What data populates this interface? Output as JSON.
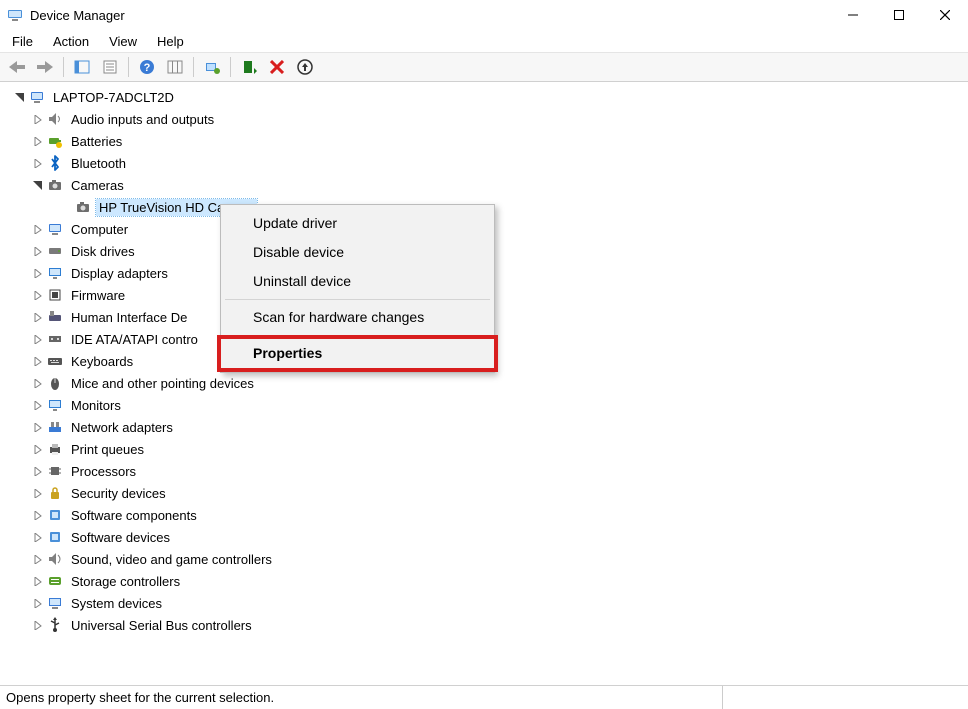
{
  "window": {
    "title": "Device Manager"
  },
  "menu": {
    "file": "File",
    "action": "Action",
    "view": "View",
    "help": "Help"
  },
  "toolbar": {
    "back": "Back",
    "forward": "Forward",
    "show_hide": "Show/Hide Console Tree",
    "properties": "Properties",
    "help": "Help",
    "refresh": "Refresh",
    "update": "Update Driver",
    "scan": "Scan for hardware changes",
    "uninstall": "Uninstall Device",
    "add_legacy": "Add legacy hardware"
  },
  "tree": {
    "root": {
      "label": "LAPTOP-7ADCLT2D",
      "icon": "computer",
      "expanded": true
    },
    "children": [
      {
        "label": "Audio inputs and outputs",
        "icon": "speaker",
        "expanded": false
      },
      {
        "label": "Batteries",
        "icon": "battery",
        "expanded": false
      },
      {
        "label": "Bluetooth",
        "icon": "bluetooth",
        "expanded": false
      },
      {
        "label": "Cameras",
        "icon": "camera",
        "expanded": true,
        "children": [
          {
            "label": "HP TrueVision HD Camera",
            "icon": "camera",
            "selected": true
          }
        ]
      },
      {
        "label": "Computer",
        "icon": "computer",
        "expanded": false
      },
      {
        "label": "Disk drives",
        "icon": "disk",
        "expanded": false
      },
      {
        "label": "Display adapters",
        "icon": "display",
        "expanded": false
      },
      {
        "label": "Firmware",
        "icon": "firmware",
        "expanded": false
      },
      {
        "label": "Human Interface Devices",
        "icon": "hid",
        "expanded": false,
        "clip": "Human Interface De"
      },
      {
        "label": "IDE ATA/ATAPI controllers",
        "icon": "ide",
        "expanded": false,
        "clip": "IDE ATA/ATAPI contro"
      },
      {
        "label": "Keyboards",
        "icon": "keyboard",
        "expanded": false
      },
      {
        "label": "Mice and other pointing devices",
        "icon": "mouse",
        "expanded": false
      },
      {
        "label": "Monitors",
        "icon": "monitor",
        "expanded": false
      },
      {
        "label": "Network adapters",
        "icon": "network",
        "expanded": false
      },
      {
        "label": "Print queues",
        "icon": "printer",
        "expanded": false
      },
      {
        "label": "Processors",
        "icon": "cpu",
        "expanded": false
      },
      {
        "label": "Security devices",
        "icon": "security",
        "expanded": false
      },
      {
        "label": "Software components",
        "icon": "software",
        "expanded": false
      },
      {
        "label": "Software devices",
        "icon": "software",
        "expanded": false
      },
      {
        "label": "Sound, video and game controllers",
        "icon": "sound",
        "expanded": false
      },
      {
        "label": "Storage controllers",
        "icon": "storage",
        "expanded": false
      },
      {
        "label": "System devices",
        "icon": "system",
        "expanded": false
      },
      {
        "label": "Universal Serial Bus controllers",
        "icon": "usb",
        "expanded": false
      }
    ]
  },
  "context_menu": {
    "items": [
      {
        "label": "Update driver"
      },
      {
        "label": "Disable device"
      },
      {
        "label": "Uninstall device"
      },
      {
        "sep": true
      },
      {
        "label": "Scan for hardware changes"
      },
      {
        "sep": true
      },
      {
        "label": "Properties",
        "bold": true,
        "highlighted": true
      }
    ]
  },
  "status": {
    "text": "Opens property sheet for the current selection."
  },
  "icons": {
    "computer": "#3a7bd5",
    "speaker": "#808080",
    "battery": "#5aa02c",
    "bluetooth": "#0a63c2",
    "camera": "#6e6e6e",
    "disk": "#7a7a7a",
    "display": "#2d7dd2",
    "firmware": "#444",
    "hid": "#557",
    "ide": "#666",
    "keyboard": "#555",
    "mouse": "#555",
    "monitor": "#2d7dd2",
    "network": "#3a7bd5",
    "printer": "#555",
    "cpu": "#666",
    "security": "#caa21f",
    "software": "#4a90d9",
    "sound": "#808080",
    "storage": "#5aa02c",
    "system": "#3a7bd5",
    "usb": "#333"
  }
}
